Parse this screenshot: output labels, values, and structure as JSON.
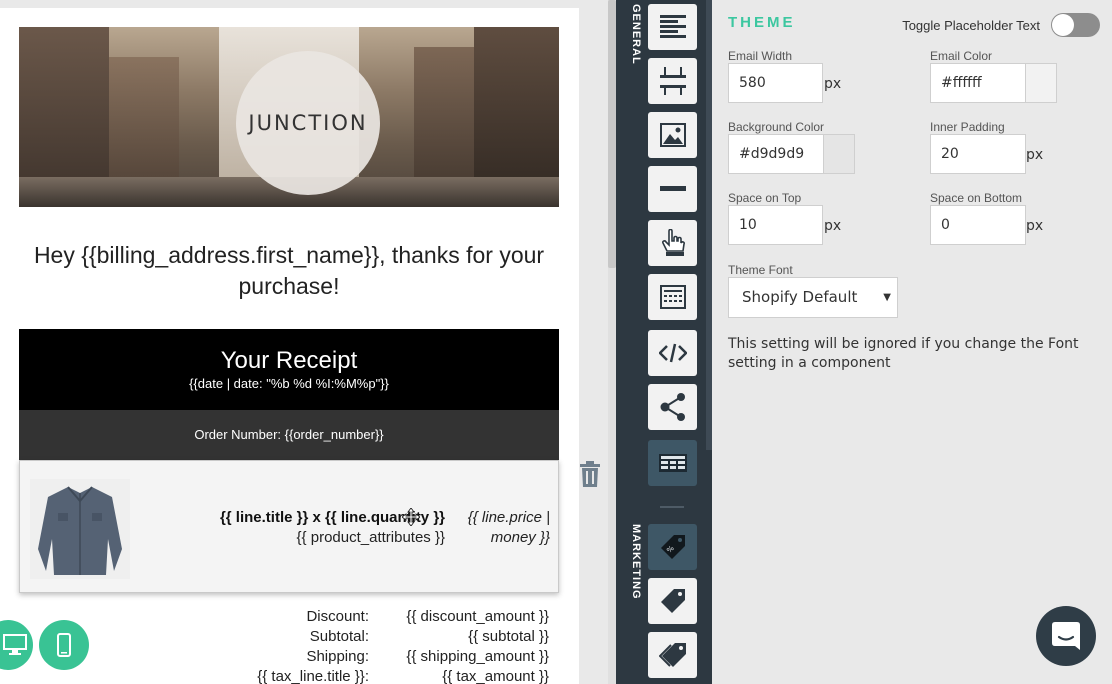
{
  "email": {
    "logo_text": "JUNCTION",
    "greeting": "Hey {{billing_address.first_name}}, thanks for your purchase!",
    "receipt_title": "Your Receipt",
    "receipt_date": "{{date | date: \"%b %d %I:%M%p\"}}",
    "order_number": "Order Number: {{order_number}}",
    "line_item": {
      "title": "{{ line.title }} x {{ line.quantity }}",
      "attributes": "{{ product_attributes }}",
      "price": "{{ line.price | money }}"
    },
    "totals": [
      {
        "label": "Discount:",
        "value": "{{ discount_amount }}"
      },
      {
        "label": "Subtotal:",
        "value": "{{ subtotal }}"
      },
      {
        "label": "Shipping:",
        "value": "{{ shipping_amount }}"
      },
      {
        "label": "{{ tax_line.title }}:",
        "value": "{{ tax_amount }}"
      }
    ]
  },
  "rail": {
    "general_label": "GENERAL",
    "marketing_label": "MARKETING",
    "general_items": [
      "text-align-icon",
      "spacer-icon",
      "image-icon",
      "divider-icon",
      "button-pointer-icon",
      "table-layout-icon",
      "code-icon",
      "share-icon",
      "product-table-icon"
    ],
    "marketing_items": [
      "discount-tag-icon",
      "tag-icon",
      "tags-icon"
    ]
  },
  "panel": {
    "title": "THEME",
    "toggle_label": "Toggle Placeholder Text",
    "toggle_on": false,
    "email_width": {
      "label": "Email Width",
      "value": "580",
      "unit": "px"
    },
    "email_color": {
      "label": "Email Color",
      "value": "#ffffff",
      "swatch": "#f2f2f2"
    },
    "background_color": {
      "label": "Background Color",
      "value": "#d9d9d9",
      "swatch": "#e5e5e5"
    },
    "inner_padding": {
      "label": "Inner Padding",
      "value": "20",
      "unit": "px"
    },
    "space_top": {
      "label": "Space on Top",
      "value": "10",
      "unit": "px"
    },
    "space_bottom": {
      "label": "Space on Bottom",
      "value": "0",
      "unit": "px"
    },
    "theme_font": {
      "label": "Theme Font",
      "value": "Shopify Default"
    },
    "font_note": "This setting will be ignored if you change the Font setting in a component"
  },
  "colors": {
    "accent": "#3cc7a0",
    "device_button": "#39c394",
    "rail_bg": "#2d3841",
    "panel_bg": "#e9e9e9"
  }
}
